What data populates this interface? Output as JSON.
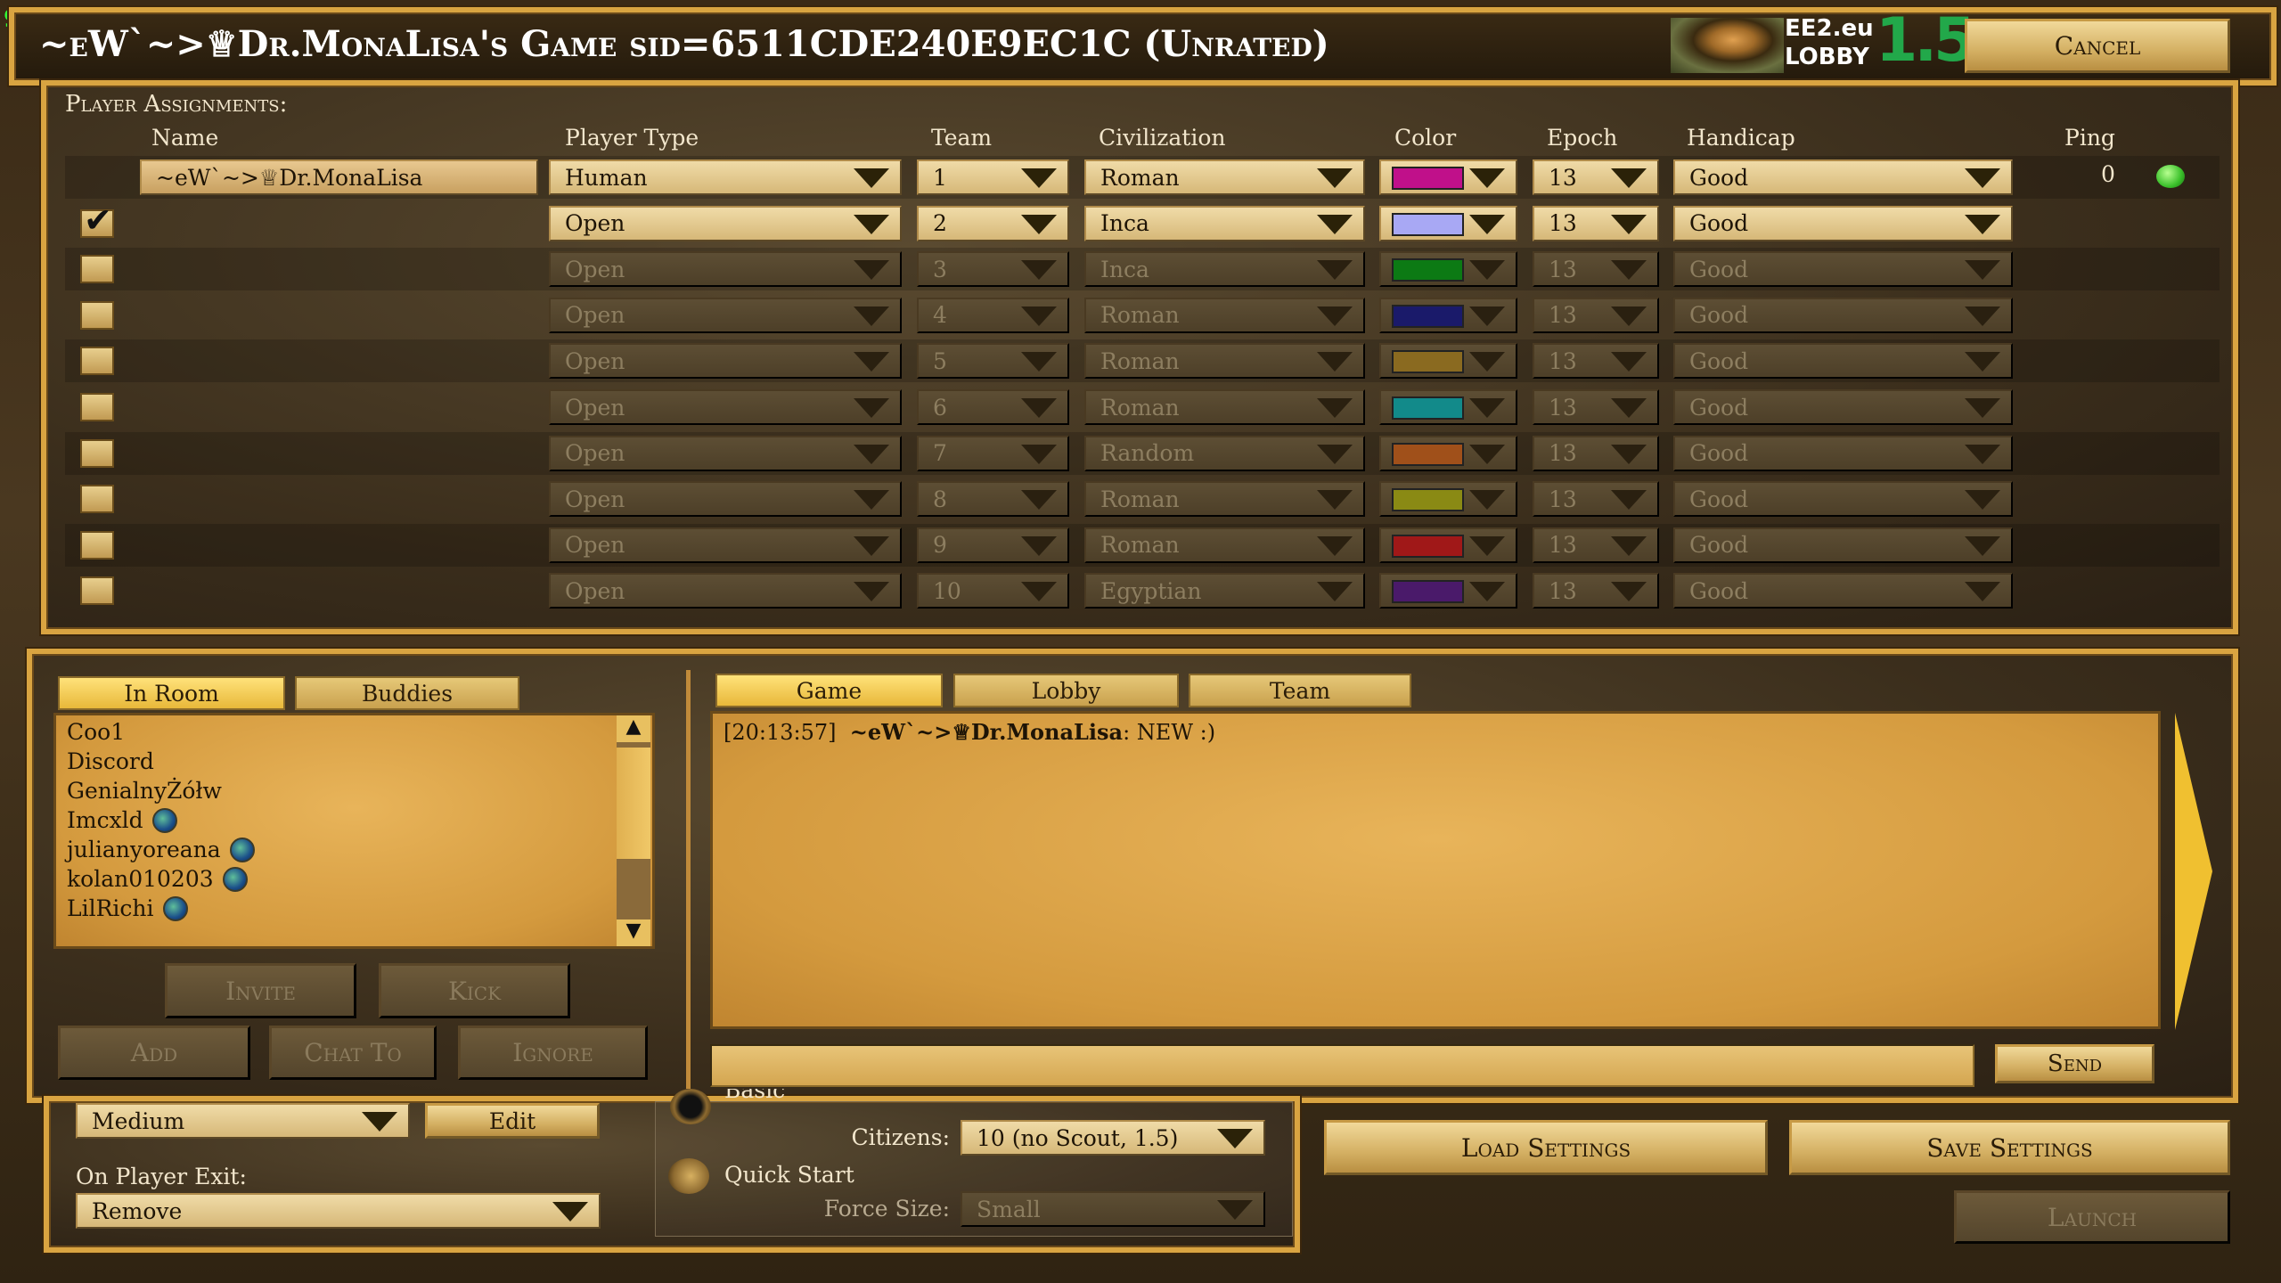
{
  "fps": "91",
  "title": "~eW`~>♕Dr.MonaLisa's Game sid=6511CDE240E9EC1C (Unrated)",
  "logo": {
    "line1": "EE2.eu",
    "line2": "LOBBY",
    "version": "1.5"
  },
  "cancel_label": "Cancel",
  "players": {
    "section_label": "Player Assignments:",
    "headers": {
      "name": "Name",
      "type": "Player Type",
      "team": "Team",
      "civ": "Civilization",
      "color": "Color",
      "epoch": "Epoch",
      "handicap": "Handicap",
      "ping": "Ping"
    },
    "rows": [
      {
        "name": "~eW`~>♕Dr.MonaLisa",
        "type": "Human",
        "team": "1",
        "civ": "Roman",
        "color": "#c0108a",
        "epoch": "13",
        "handicap": "Good",
        "ping": "0",
        "active": true,
        "host": true
      },
      {
        "name": "",
        "type": "Open",
        "team": "2",
        "civ": "Inca",
        "color": "#a8a8f4",
        "epoch": "13",
        "handicap": "Good",
        "checked": true,
        "active": true
      },
      {
        "name": "",
        "type": "Open",
        "team": "3",
        "civ": "Inca",
        "color": "#0c7a14",
        "epoch": "13",
        "handicap": "Good"
      },
      {
        "name": "",
        "type": "Open",
        "team": "4",
        "civ": "Roman",
        "color": "#1a1a6a",
        "epoch": "13",
        "handicap": "Good"
      },
      {
        "name": "",
        "type": "Open",
        "team": "5",
        "civ": "Roman",
        "color": "#8a6a20",
        "epoch": "13",
        "handicap": "Good"
      },
      {
        "name": "",
        "type": "Open",
        "team": "6",
        "civ": "Roman",
        "color": "#128a8a",
        "epoch": "13",
        "handicap": "Good"
      },
      {
        "name": "",
        "type": "Open",
        "team": "7",
        "civ": "Random",
        "color": "#a0501a",
        "epoch": "13",
        "handicap": "Good"
      },
      {
        "name": "",
        "type": "Open",
        "team": "8",
        "civ": "Roman",
        "color": "#8a8a14",
        "epoch": "13",
        "handicap": "Good"
      },
      {
        "name": "",
        "type": "Open",
        "team": "9",
        "civ": "Roman",
        "color": "#a01818",
        "epoch": "13",
        "handicap": "Good"
      },
      {
        "name": "",
        "type": "Open",
        "team": "10",
        "civ": "Egyptian",
        "color": "#4a1a6a",
        "epoch": "13",
        "handicap": "Good"
      }
    ]
  },
  "room": {
    "tabs": [
      "In Room",
      "Buddies"
    ],
    "active_tab": "In Room",
    "users": [
      {
        "name": "Coo1",
        "globe": false
      },
      {
        "name": "Discord",
        "globe": false
      },
      {
        "name": "GenialnyŻółw",
        "globe": false
      },
      {
        "name": "Imcxld",
        "globe": true
      },
      {
        "name": "julianyoreana",
        "globe": true
      },
      {
        "name": "kolan010203",
        "globe": true
      },
      {
        "name": "LilRichi",
        "globe": true
      }
    ],
    "buttons": {
      "invite": "Invite",
      "kick": "Kick",
      "add": "Add",
      "chat_to": "Chat To",
      "ignore": "Ignore"
    }
  },
  "chat": {
    "tabs": [
      "Game",
      "Lobby",
      "Team"
    ],
    "active_tab": "Game",
    "messages": [
      {
        "time": "[20:13:57]",
        "user": "~eW`~>♕Dr.MonaLisa",
        "text": ": NEW :)"
      }
    ],
    "input_value": "",
    "send_label": "Send"
  },
  "settings": {
    "difficulty": "Medium",
    "edit_label": "Edit",
    "on_exit_label": "On Player Exit:",
    "on_exit_value": "Remove",
    "basic_label": "Basic",
    "citizens_label": "Citizens:",
    "citizens_value": "10 (no Scout, 1.5)",
    "quick_start_label": "Quick Start",
    "force_size_label": "Force Size:",
    "force_size_value": "Small",
    "load_label": "Load Settings",
    "save_label": "Save Settings",
    "launch_label": "Launch"
  }
}
